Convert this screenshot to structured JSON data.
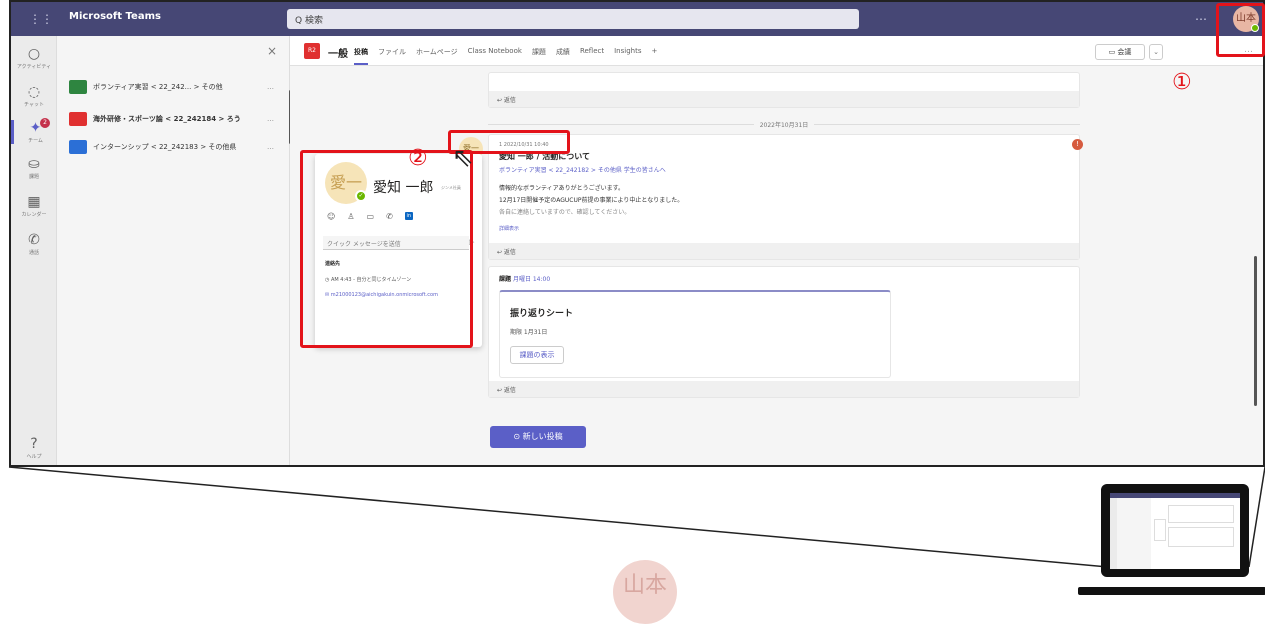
{
  "app": {
    "name": "Microsoft Teams",
    "search_placeholder": "Q 検索",
    "title_more": "…",
    "user_avatar_text": "山本"
  },
  "rail": [
    {
      "icon": "○",
      "label": "アクティビティ"
    },
    {
      "icon": "◌",
      "label": "チャット"
    },
    {
      "icon": "✦",
      "label": "チーム",
      "badge": "2"
    },
    {
      "icon": "⛀",
      "label": "課題"
    },
    {
      "icon": "▦",
      "label": "カレンダー"
    },
    {
      "icon": "✆",
      "label": "通話"
    },
    {
      "icon": "?",
      "label": "ヘルプ"
    }
  ],
  "teams": {
    "close": "×",
    "items": [
      {
        "name": "ボランティア実習 < 22_242... > その他",
        "color": "#2e8540"
      },
      {
        "name": "海外研修・スポーツ論 < 22_242184 > ろう",
        "color": "#e03030"
      },
      {
        "name": "インターンシップ < 22_242183 > その他県",
        "color": "#2b6fd6"
      }
    ],
    "more": "…"
  },
  "channel": {
    "icon_text": "R2",
    "name": "一般",
    "tabs": [
      "投稿",
      "ファイル",
      "ホームページ",
      "Class Notebook",
      "課題",
      "成績",
      "Reflect",
      "Insights",
      "+"
    ],
    "meet": "会議",
    "meet_caret": "⌄",
    "more": "…"
  },
  "messages": {
    "reply_label": "↩ 返信",
    "date_sep": "2022年10月31日",
    "post": {
      "author_avatar": "愛一",
      "meta": "1     2022/10/31 10:40",
      "title": "愛知 一郎 / 活動について",
      "link": "ボランティア実習 < 22_242182 > その他県 学生の皆さんへ",
      "body1": "情報的なボランティアありがとうございます。",
      "body2": "12月17日開催予定のAGUCUP前提の事業により中止となりました。",
      "body3": "各自に連絡していますので、確認してください。",
      "more": "詳細表示",
      "alert": "!"
    },
    "assignment": {
      "header": "課題",
      "date": "月曜日 14:00",
      "title": "振り返りシート",
      "due": "期限 1月31日",
      "button": "課題の表示"
    },
    "new_post": "⊙ 新しい投稿"
  },
  "profile": {
    "avatar": "愛一",
    "status_icon": "✓",
    "name": "愛知 一郎",
    "subtitle": "ジンメ社員",
    "actions": [
      "☺",
      "♙",
      "▭",
      "✆",
      "in"
    ],
    "quick_placeholder": "クイック メッセージを送信",
    "send_icon": "▷",
    "contact_header": "連絡先",
    "time": "◷  AM 4:43 - 自分と同じタイムゾーン",
    "email": "✉  m21000123@aichigakuin.onmicrosoft.com"
  },
  "annotations": {
    "one": "①",
    "two": "②"
  },
  "bottom": {
    "avatar_text": "山本"
  }
}
